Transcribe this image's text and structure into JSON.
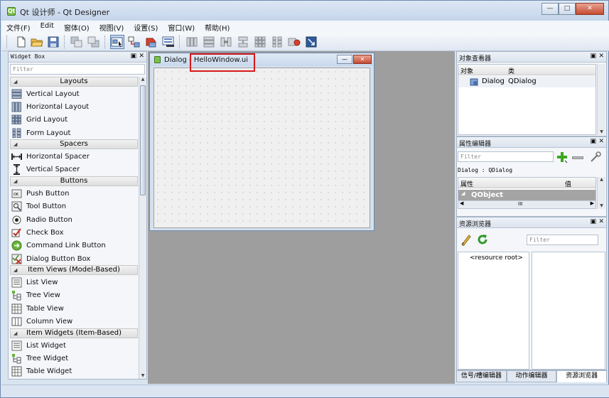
{
  "app": {
    "title": "Qt 设计师 - Qt Designer",
    "icon": "qt-designer-icon"
  },
  "window_controls": {
    "minimize": "—",
    "maximize": "□",
    "close": "✕"
  },
  "menu": [
    "文件(F)",
    "Edit",
    "窗体(O)",
    "视图(V)",
    "设置(S)",
    "窗口(W)",
    "帮助(H)"
  ],
  "toolbar": {
    "icons": [
      "new-file-icon",
      "open-folder-icon",
      "save-icon",
      "send-to-back-icon",
      "bring-to-front-icon",
      "edit-widgets-icon",
      "edit-signals-slots-icon",
      "edit-buddies-icon",
      "edit-tab-order-icon",
      "layout-horizontal-icon",
      "layout-vertical-icon",
      "layout-horizontal-splitter-icon",
      "layout-vertical-splitter-icon",
      "layout-grid-icon",
      "layout-form-icon",
      "break-layout-icon",
      "adjust-size-icon"
    ]
  },
  "widget_box": {
    "title": "Widget Box",
    "filter_placeholder": "Filter",
    "categories": [
      {
        "label": "Layouts",
        "items": [
          {
            "label": "Vertical Layout",
            "icon": "vertical-layout-icon"
          },
          {
            "label": "Horizontal Layout",
            "icon": "horizontal-layout-icon"
          },
          {
            "label": "Grid Layout",
            "icon": "grid-layout-icon"
          },
          {
            "label": "Form Layout",
            "icon": "form-layout-icon"
          }
        ]
      },
      {
        "label": "Spacers",
        "items": [
          {
            "label": "Horizontal Spacer",
            "icon": "horizontal-spacer-icon"
          },
          {
            "label": "Vertical Spacer",
            "icon": "vertical-spacer-icon"
          }
        ]
      },
      {
        "label": "Buttons",
        "items": [
          {
            "label": "Push Button",
            "icon": "push-button-icon"
          },
          {
            "label": "Tool Button",
            "icon": "tool-button-icon"
          },
          {
            "label": "Radio Button",
            "icon": "radio-button-icon"
          },
          {
            "label": "Check Box",
            "icon": "check-box-icon"
          },
          {
            "label": "Command Link Button",
            "icon": "command-link-icon"
          },
          {
            "label": "Dialog Button Box",
            "icon": "dialog-button-box-icon"
          }
        ]
      },
      {
        "label": "Item Views (Model-Based)",
        "items": [
          {
            "label": "List View",
            "icon": "list-view-icon"
          },
          {
            "label": "Tree View",
            "icon": "tree-view-icon"
          },
          {
            "label": "Table View",
            "icon": "table-view-icon"
          },
          {
            "label": "Column View",
            "icon": "column-view-icon"
          }
        ]
      },
      {
        "label": "Item Widgets (Item-Based)",
        "items": [
          {
            "label": "List Widget",
            "icon": "list-widget-icon"
          },
          {
            "label": "Tree Widget",
            "icon": "tree-widget-icon"
          },
          {
            "label": "Table Widget",
            "icon": "table-widget-icon"
          }
        ]
      }
    ]
  },
  "form": {
    "title_prefix": "Dialog - ",
    "title_file": "HelloWindow.ui"
  },
  "object_inspector": {
    "title": "对象查看器",
    "col_object": "对象",
    "col_class": "类",
    "row": {
      "object": "Dialog",
      "class": "QDialog"
    }
  },
  "property_editor": {
    "title": "属性编辑器",
    "filter_placeholder": "Filter",
    "context": "Dialog : QDialog",
    "col_property": "属性",
    "col_value": "值",
    "group": "QObject",
    "scroll_mark": "III"
  },
  "resource_browser": {
    "title": "资源浏览器",
    "filter_placeholder": "Filter",
    "root": "<resource root>"
  },
  "bottom_tabs": [
    "信号/槽编辑器",
    "动作编辑器",
    "资源浏览器"
  ]
}
